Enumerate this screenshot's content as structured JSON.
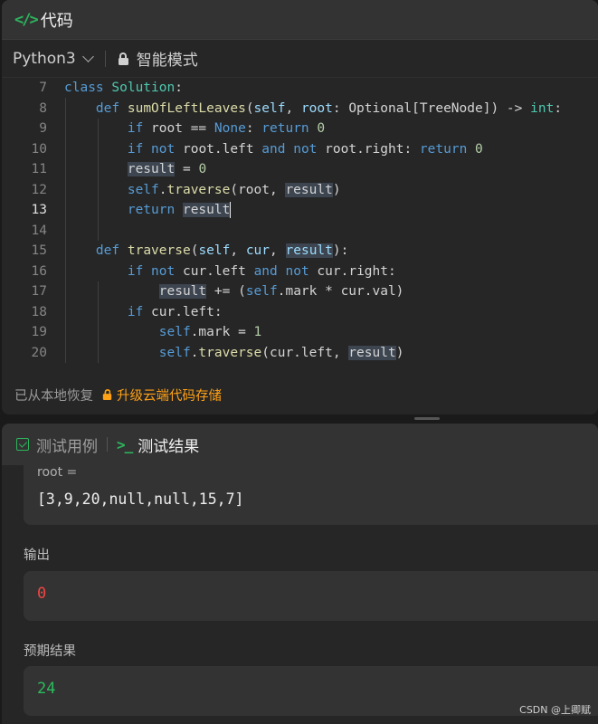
{
  "code_panel": {
    "icon": "code-icon",
    "title": "代码",
    "language": "Python3",
    "mode_label": "智能模式",
    "status_saved": "已从本地恢复",
    "status_upgrade": "升级云端代码存储",
    "lines": [
      {
        "num": "7",
        "tokens": [
          {
            "t": "class",
            "c": "kw"
          },
          {
            "t": " "
          },
          {
            "t": "Solution",
            "c": "cls"
          },
          {
            "t": ":"
          }
        ]
      },
      {
        "num": "8",
        "tokens": [
          {
            "t": "    "
          },
          {
            "t": "def",
            "c": "kw"
          },
          {
            "t": " "
          },
          {
            "t": "sumOfLeftLeaves",
            "c": "fn"
          },
          {
            "t": "("
          },
          {
            "t": "self",
            "c": "pm"
          },
          {
            "t": ", "
          },
          {
            "t": "root",
            "c": "pm"
          },
          {
            "t": ": Optional[TreeNode]) -> "
          },
          {
            "t": "int",
            "c": "cls"
          },
          {
            "t": ":"
          }
        ]
      },
      {
        "num": "9",
        "tokens": [
          {
            "t": "        "
          },
          {
            "t": "if",
            "c": "kw"
          },
          {
            "t": " root == "
          },
          {
            "t": "None",
            "c": "kw"
          },
          {
            "t": ": "
          },
          {
            "t": "return",
            "c": "kw"
          },
          {
            "t": " "
          },
          {
            "t": "0",
            "c": "num"
          }
        ]
      },
      {
        "num": "10",
        "tokens": [
          {
            "t": "        "
          },
          {
            "t": "if",
            "c": "kw"
          },
          {
            "t": " "
          },
          {
            "t": "not",
            "c": "kw"
          },
          {
            "t": " root.left "
          },
          {
            "t": "and",
            "c": "kw"
          },
          {
            "t": " "
          },
          {
            "t": "not",
            "c": "kw"
          },
          {
            "t": " root.right: "
          },
          {
            "t": "return",
            "c": "kw"
          },
          {
            "t": " "
          },
          {
            "t": "0",
            "c": "num"
          }
        ]
      },
      {
        "num": "11",
        "tokens": [
          {
            "t": "        "
          },
          {
            "t": "result",
            "h": 1
          },
          {
            "t": " = "
          },
          {
            "t": "0",
            "c": "num"
          }
        ]
      },
      {
        "num": "12",
        "tokens": [
          {
            "t": "        "
          },
          {
            "t": "self",
            "c": "kw"
          },
          {
            "t": "."
          },
          {
            "t": "traverse",
            "c": "fn"
          },
          {
            "t": "(root, "
          },
          {
            "t": "result",
            "h": 1
          },
          {
            "t": ")"
          }
        ]
      },
      {
        "num": "13",
        "active": true,
        "tokens": [
          {
            "t": "        "
          },
          {
            "t": "return",
            "c": "kw"
          },
          {
            "t": " "
          },
          {
            "t": "result",
            "h": 1,
            "cursor": 1
          }
        ]
      },
      {
        "num": "14",
        "tokens": []
      },
      {
        "num": "15",
        "tokens": [
          {
            "t": "    "
          },
          {
            "t": "def",
            "c": "kw"
          },
          {
            "t": " "
          },
          {
            "t": "traverse",
            "c": "fn"
          },
          {
            "t": "("
          },
          {
            "t": "self",
            "c": "pm"
          },
          {
            "t": ", "
          },
          {
            "t": "cur",
            "c": "pm"
          },
          {
            "t": ", "
          },
          {
            "t": "result",
            "c": "pm",
            "h": 1
          },
          {
            "t": "):"
          }
        ]
      },
      {
        "num": "16",
        "tokens": [
          {
            "t": "        "
          },
          {
            "t": "if",
            "c": "kw"
          },
          {
            "t": " "
          },
          {
            "t": "not",
            "c": "kw"
          },
          {
            "t": " cur.left "
          },
          {
            "t": "and",
            "c": "kw"
          },
          {
            "t": " "
          },
          {
            "t": "not",
            "c": "kw"
          },
          {
            "t": " cur.right:"
          }
        ]
      },
      {
        "num": "17",
        "tokens": [
          {
            "t": "            "
          },
          {
            "t": "result",
            "h": 1
          },
          {
            "t": " += ("
          },
          {
            "t": "self",
            "c": "kw"
          },
          {
            "t": ".mark * cur.val)"
          }
        ]
      },
      {
        "num": "18",
        "tokens": [
          {
            "t": "        "
          },
          {
            "t": "if",
            "c": "kw"
          },
          {
            "t": " cur.left:"
          }
        ]
      },
      {
        "num": "19",
        "tokens": [
          {
            "t": "            "
          },
          {
            "t": "self",
            "c": "kw"
          },
          {
            "t": ".mark = "
          },
          {
            "t": "1",
            "c": "num"
          }
        ]
      },
      {
        "num": "20",
        "tokens": [
          {
            "t": "            "
          },
          {
            "t": "self",
            "c": "kw"
          },
          {
            "t": "."
          },
          {
            "t": "traverse",
            "c": "fn"
          },
          {
            "t": "(cur.left, "
          },
          {
            "t": "result",
            "h": 1
          },
          {
            "t": ")"
          }
        ]
      }
    ]
  },
  "result_panel": {
    "tab_cases": "测试用例",
    "tab_results": "测试结果",
    "input_label": "root =",
    "input_value": "[3,9,20,null,null,15,7]",
    "output_label": "输出",
    "output_value": "0",
    "expected_label": "预期结果",
    "expected_value": "24"
  },
  "watermark": "CSDN @上卿赋",
  "colors": {
    "accent_green": "#2db55d",
    "accent_orange": "#ffa116",
    "error_red": "#ef4743",
    "keyword": "#569cd6",
    "class": "#4ec9b0",
    "function": "#dcdcaa",
    "param": "#9cdcfe",
    "number": "#b5cea8"
  }
}
